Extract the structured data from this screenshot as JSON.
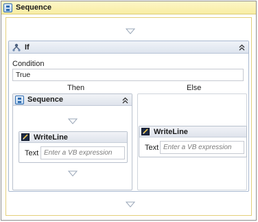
{
  "outer_sequence": {
    "title": "Sequence"
  },
  "if_activity": {
    "title": "If",
    "condition_label": "Condition",
    "condition_value": "True",
    "then_label": "Then",
    "else_label": "Else"
  },
  "then_sequence": {
    "title": "Sequence",
    "writeline": {
      "title": "WriteLine",
      "text_label": "Text",
      "text_placeholder": "Enter a VB expression"
    }
  },
  "else_branch": {
    "writeline": {
      "title": "WriteLine",
      "text_label": "Text",
      "text_placeholder": "Enter a VB expression"
    }
  },
  "icons": {
    "sequence": "sequence-icon",
    "if": "if-icon",
    "writeline": "writeline-icon",
    "collapse": "chevron-up-double-icon",
    "drop_target": "drop-arrow-icon"
  },
  "colors": {
    "outer_header": "#f8eda3",
    "outer_border_accent": "#e3cf7a",
    "activity_header": "#dfe4ec",
    "activity_border": "#b9c1cd"
  }
}
